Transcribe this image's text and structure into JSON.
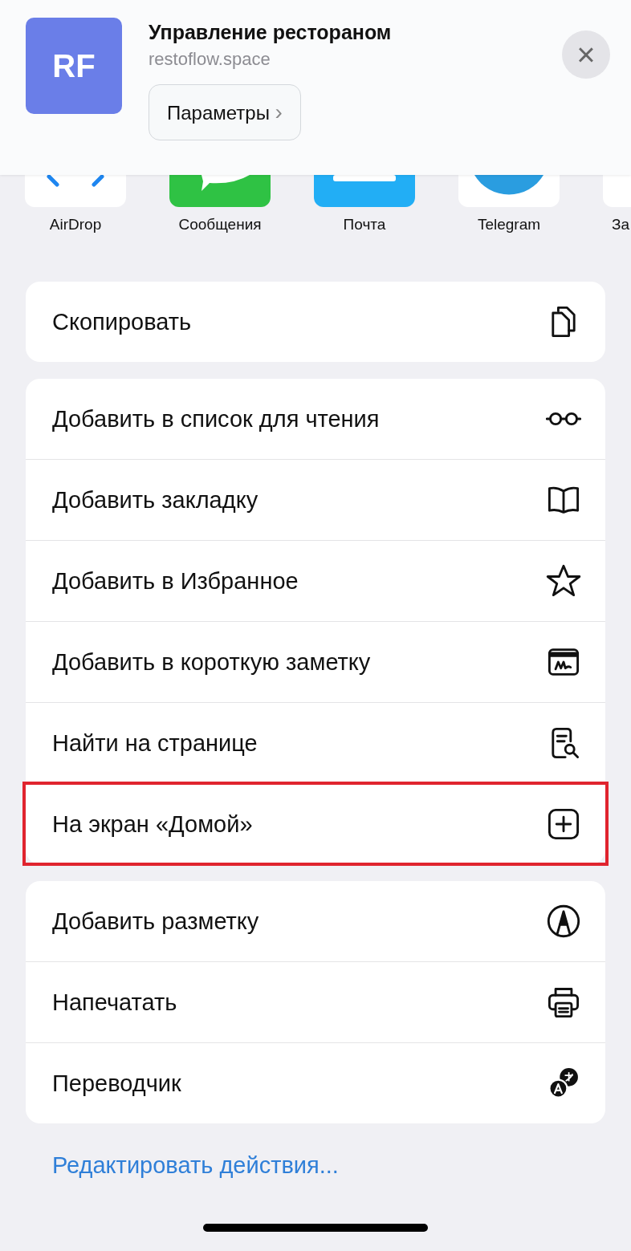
{
  "header": {
    "logo": "RF",
    "title": "Управление рестораном",
    "url": "restoflow.space",
    "options_button": "Параметры",
    "chevron": "›",
    "close": "×"
  },
  "apps": [
    {
      "kind": "airdrop",
      "label": "AirDrop"
    },
    {
      "kind": "messages",
      "label": "Сообщения"
    },
    {
      "kind": "mail",
      "label": "Почта"
    },
    {
      "kind": "telegram",
      "label": "Telegram"
    },
    {
      "kind": "blank",
      "label": "За"
    }
  ],
  "groups": [
    [
      {
        "label": "Скопировать",
        "kind": "copy",
        "highlighted": false
      }
    ],
    [
      {
        "label": "Добавить в список для чтения",
        "kind": "glasses",
        "highlighted": false
      },
      {
        "label": "Добавить закладку",
        "kind": "book",
        "highlighted": false
      },
      {
        "label": "Добавить в Избранное",
        "kind": "star",
        "highlighted": false
      },
      {
        "label": "Добавить в короткую заметку",
        "kind": "note",
        "highlighted": false
      },
      {
        "label": "Найти на странице",
        "kind": "find",
        "highlighted": false
      },
      {
        "label": "На экран «Домой»",
        "kind": "addsquare",
        "highlighted": true
      }
    ],
    [
      {
        "label": "Добавить разметку",
        "kind": "markup",
        "highlighted": false
      },
      {
        "label": "Напечатать",
        "kind": "print",
        "highlighted": false
      },
      {
        "label": "Переводчик",
        "kind": "translate",
        "highlighted": false
      }
    ]
  ],
  "edit_actions": "Редактировать действия..."
}
